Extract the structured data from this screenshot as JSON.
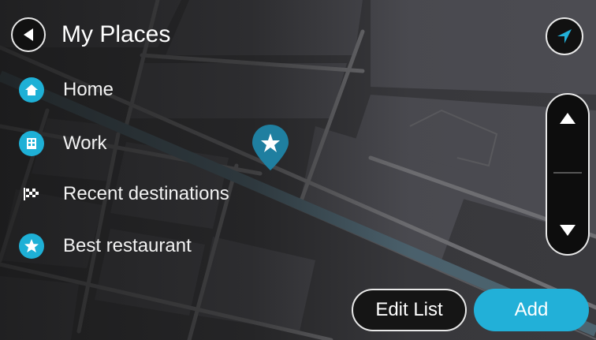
{
  "header": {
    "title": "My Places"
  },
  "places": [
    {
      "label": "Home",
      "icon": "home-icon"
    },
    {
      "label": "Work",
      "icon": "work-building-icon"
    },
    {
      "label": "Recent destinations",
      "icon": "checkered-flag-icon"
    },
    {
      "label": "Best restaurant",
      "icon": "star-icon"
    }
  ],
  "buttons": {
    "edit_list": "Edit List",
    "add": "Add"
  },
  "colors": {
    "accent": "#22b0d8",
    "button_dark": "#151515",
    "border": "#e8e8e8",
    "map_road": "#6e6e70"
  }
}
